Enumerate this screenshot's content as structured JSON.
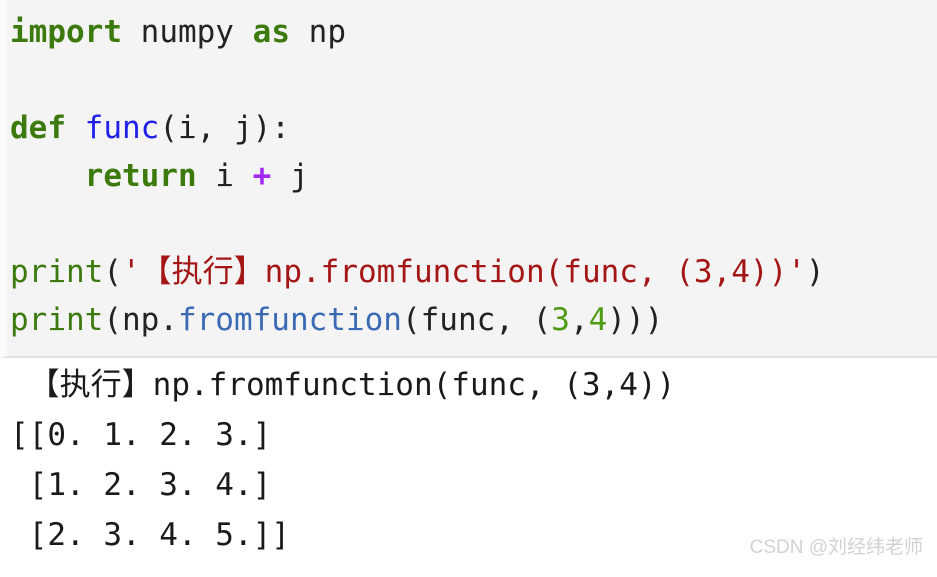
{
  "code_block": {
    "language": "python",
    "background_color": "#f4f4f4",
    "lines": [
      {
        "id": "line-import",
        "tokens": [
          {
            "text": "import",
            "type": "keyword"
          },
          {
            "text": " ",
            "type": "plain"
          },
          {
            "text": "numpy",
            "type": "plain"
          },
          {
            "text": " ",
            "type": "plain"
          },
          {
            "text": "as",
            "type": "keyword"
          },
          {
            "text": " ",
            "type": "plain"
          },
          {
            "text": "np",
            "type": "plain"
          }
        ]
      },
      {
        "id": "line-blank-1",
        "tokens": []
      },
      {
        "id": "line-def",
        "tokens": [
          {
            "text": "def",
            "type": "keyword"
          },
          {
            "text": " ",
            "type": "plain"
          },
          {
            "text": "func",
            "type": "function-def"
          },
          {
            "text": "(i, j):",
            "type": "plain"
          }
        ]
      },
      {
        "id": "line-return",
        "tokens": [
          {
            "text": "    ",
            "type": "plain"
          },
          {
            "text": "return",
            "type": "keyword"
          },
          {
            "text": " i ",
            "type": "plain"
          },
          {
            "text": "+",
            "type": "operator"
          },
          {
            "text": " j",
            "type": "plain"
          }
        ]
      },
      {
        "id": "line-blank-2",
        "tokens": []
      },
      {
        "id": "line-print-label",
        "tokens": [
          {
            "text": "print",
            "type": "builtin"
          },
          {
            "text": "(",
            "type": "plain"
          },
          {
            "text": "'【执行】np.fromfunction(func, (3,4))'",
            "type": "string"
          },
          {
            "text": ")",
            "type": "plain"
          }
        ]
      },
      {
        "id": "line-print-value",
        "tokens": [
          {
            "text": "print",
            "type": "builtin"
          },
          {
            "text": "(np.",
            "type": "plain"
          },
          {
            "text": "fromfunction",
            "type": "attribute"
          },
          {
            "text": "(func, (",
            "type": "plain"
          },
          {
            "text": "3",
            "type": "number"
          },
          {
            "text": ",",
            "type": "plain"
          },
          {
            "text": "4",
            "type": "number"
          },
          {
            "text": ")))",
            "type": "plain"
          }
        ]
      }
    ]
  },
  "output_block": {
    "background_color": "#ffffff",
    "lines": [
      " 【执行】np.fromfunction(func, (3,4))",
      "[[0. 1. 2. 3.]",
      " [1. 2. 3. 4.]",
      " [2. 3. 4. 5.]]"
    ]
  },
  "watermark": {
    "text": "CSDN @刘经纬老师",
    "color": "#d2d2d2"
  }
}
